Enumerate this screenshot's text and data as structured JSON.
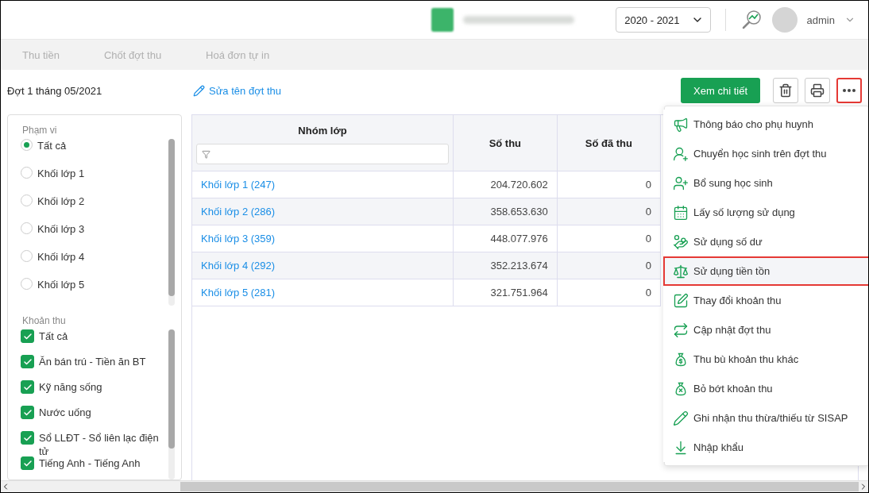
{
  "header": {
    "year": "2020 - 2021",
    "user": "admin"
  },
  "tabs": [
    "Thu tiền",
    "Chốt đợt thu",
    "Hoá đơn tự in"
  ],
  "toolbar": {
    "title": "Đợt 1 tháng 05/2021",
    "rename_link": "Sửa tên đợt thu",
    "primary_button": "Xem chi tiết"
  },
  "filters": {
    "scope": {
      "title": "Phạm vi",
      "options": [
        {
          "label": "Tất cả",
          "selected": true
        },
        {
          "label": "Khối lớp 1",
          "selected": false
        },
        {
          "label": "Khối lớp 2",
          "selected": false
        },
        {
          "label": "Khối lớp 3",
          "selected": false
        },
        {
          "label": "Khối lớp 4",
          "selected": false
        },
        {
          "label": "Khối lớp 5",
          "selected": false
        }
      ]
    },
    "fees": {
      "title": "Khoản thu",
      "items": [
        {
          "label": "Tất cả",
          "checked": true
        },
        {
          "label": "Ăn bán trú - Tiền ăn BT",
          "checked": true
        },
        {
          "label": "Kỹ năng sống",
          "checked": true
        },
        {
          "label": "Nước uống",
          "checked": true
        },
        {
          "label": "Sổ LLĐT - Sổ liên lạc điện tử",
          "checked": true
        },
        {
          "label": "Tiếng Anh - Tiếng Anh",
          "checked": true
        }
      ]
    }
  },
  "table": {
    "columns": [
      "Nhóm lớp",
      "Số thu",
      "Số đã thu"
    ],
    "rows": [
      [
        "Khối lớp 1 (247)",
        "204.720.602",
        "0"
      ],
      [
        "Khối lớp 2 (286)",
        "358.653.630",
        "0"
      ],
      [
        "Khối lớp 3 (359)",
        "448.077.976",
        "0"
      ],
      [
        "Khối lớp 4 (292)",
        "352.213.674",
        "0"
      ],
      [
        "Khối lớp 5 (281)",
        "321.751.964",
        "0"
      ]
    ]
  },
  "menu": {
    "items": [
      {
        "label": "Thông báo cho phụ huynh",
        "selected": false
      },
      {
        "label": "Chuyển học sinh trên đợt thu",
        "selected": false
      },
      {
        "label": "Bổ sung học sinh",
        "selected": false
      },
      {
        "label": "Lấy số lượng sử dụng",
        "selected": false
      },
      {
        "label": "Sử dụng số dư",
        "selected": false
      },
      {
        "label": "Sử dụng tiền tồn",
        "selected": true
      },
      {
        "label": "Thay đổi khoản thu",
        "selected": false
      },
      {
        "label": "Cập nhật đợt thu",
        "selected": false
      },
      {
        "label": "Thu bù khoản thu khác",
        "selected": false
      },
      {
        "label": "Bỏ bớt khoản thu",
        "selected": false
      },
      {
        "label": "Ghi nhận thu thừa/thiếu từ SISAP",
        "selected": false
      },
      {
        "label": "Nhập khẩu",
        "selected": false
      }
    ]
  }
}
